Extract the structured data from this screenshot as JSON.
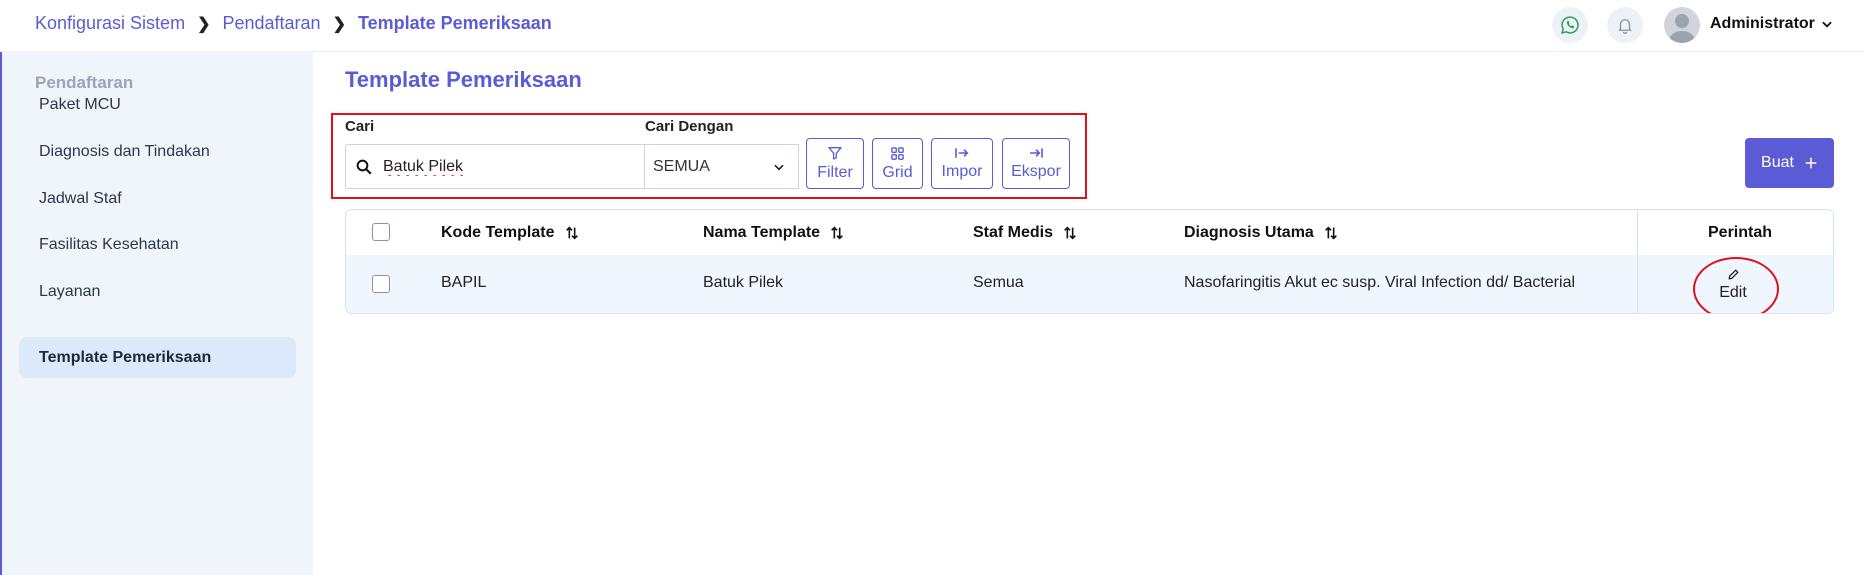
{
  "breadcrumb": {
    "items": [
      "Konfigurasi Sistem",
      "Pendaftaran",
      "Template Pemeriksaan"
    ]
  },
  "header": {
    "user_name": "Administrator",
    "icons": [
      "whatsapp-icon",
      "bell-icon",
      "avatar",
      "chevron-down-icon"
    ]
  },
  "sidebar": {
    "section": "Pendaftaran",
    "items": [
      {
        "label": "Paket MCU",
        "active": false
      },
      {
        "label": "Diagnosis dan Tindakan",
        "active": false
      },
      {
        "label": "Jadwal Staf",
        "active": false
      },
      {
        "label": "Fasilitas Kesehatan",
        "active": false
      },
      {
        "label": "Layanan",
        "active": false
      },
      {
        "label": "Template Pemeriksaan",
        "active": true
      }
    ]
  },
  "main": {
    "title": "Template Pemeriksaan",
    "search": {
      "label": "Cari",
      "value": "Batuk Pilek"
    },
    "search_by": {
      "label": "Cari Dengan",
      "selected": "SEMUA"
    },
    "tools": {
      "filter": "Filter",
      "grid": "Grid",
      "import": "Impor",
      "export": "Ekspor"
    },
    "create_button": "Buat"
  },
  "table": {
    "columns": [
      "Kode Template",
      "Nama Template",
      "Staf Medis",
      "Diagnosis Utama",
      "Perintah"
    ],
    "rows": [
      {
        "kode": "BAPIL",
        "nama": "Batuk Pilek",
        "staf": "Semua",
        "diagnosis": "Nasofaringitis Akut ec susp. Viral Infection dd/ Bacterial",
        "action": "Edit"
      }
    ]
  },
  "colors": {
    "accent": "#5b5bd6",
    "annotation_red": "#e0101e",
    "sidebar_bg": "#f0f5fc",
    "row_bg": "#f0f6fd"
  }
}
